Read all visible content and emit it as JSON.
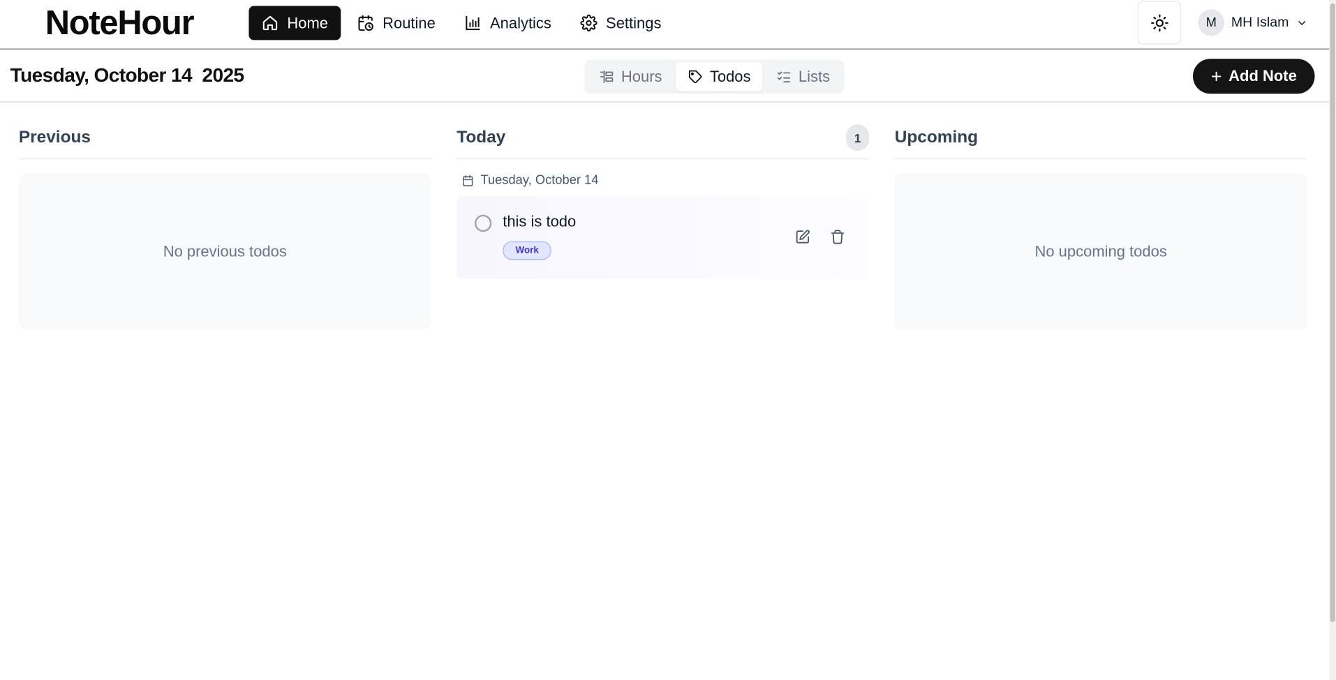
{
  "app": {
    "logo": "NoteHour"
  },
  "nav": [
    {
      "label": "Home",
      "icon": "home-icon"
    },
    {
      "label": "Routine",
      "icon": "calendar-clock-icon"
    },
    {
      "label": "Analytics",
      "icon": "bar-chart-icon"
    },
    {
      "label": "Settings",
      "icon": "gear-icon"
    }
  ],
  "user": {
    "initial": "M",
    "name": "MH Islam"
  },
  "subbar": {
    "date_title": "Tuesday, October 14  2025",
    "tabs": [
      {
        "label": "Hours",
        "icon": "hours-icon"
      },
      {
        "label": "Todos",
        "icon": "tag-icon"
      },
      {
        "label": "Lists",
        "icon": "checklist-icon"
      }
    ],
    "active_tab": "Todos",
    "add_button": "Add Note"
  },
  "columns": {
    "previous": {
      "title": "Previous",
      "empty": "No previous todos"
    },
    "today": {
      "title": "Today",
      "count": "1",
      "date_label": "Tuesday, October 14",
      "todos": [
        {
          "text": "this is todo",
          "tag": "Work",
          "done": false
        }
      ]
    },
    "upcoming": {
      "title": "Upcoming",
      "empty": "No upcoming todos"
    }
  },
  "colors": {
    "primary": "#111111",
    "tag_bg": "#e0e7ff",
    "tag_text": "#4338ca"
  }
}
